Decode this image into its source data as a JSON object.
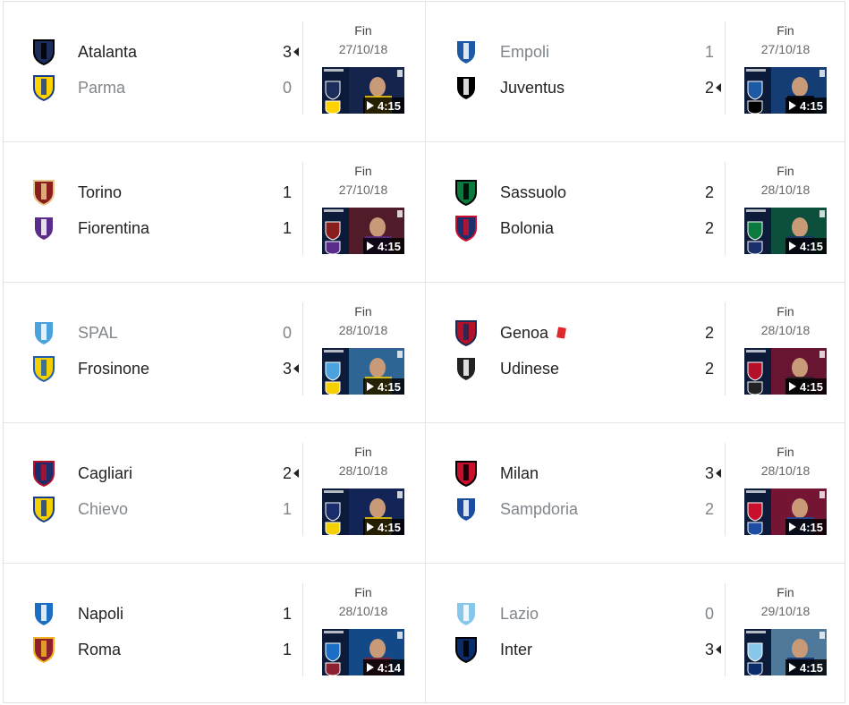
{
  "matches": [
    {
      "status": "Fin",
      "date": "27/10/18",
      "duration": "4:15",
      "winner": 1,
      "home": {
        "name": "Atalanta",
        "score": "3",
        "logo": "atalanta-crest-icon",
        "c1": "#1c2c5b",
        "c2": "#000000"
      },
      "away": {
        "name": "Parma",
        "score": "0",
        "logo": "parma-crest-icon",
        "c1": "#ffd200",
        "c2": "#1a3e8c"
      }
    },
    {
      "status": "Fin",
      "date": "27/10/18",
      "duration": "4:15",
      "winner": 2,
      "home": {
        "name": "Empoli",
        "score": "1",
        "logo": "empoli-crest-icon",
        "c1": "#1c5aa6",
        "c2": "#ffffff"
      },
      "away": {
        "name": "Juventus",
        "score": "2",
        "logo": "juventus-crest-icon",
        "c1": "#000000",
        "c2": "#ffffff"
      }
    },
    {
      "status": "Fin",
      "date": "27/10/18",
      "duration": "4:15",
      "winner": 0,
      "home": {
        "name": "Torino",
        "score": "1",
        "logo": "torino-crest-icon",
        "c1": "#8a1e1e",
        "c2": "#e8c58a"
      },
      "away": {
        "name": "Fiorentina",
        "score": "1",
        "logo": "fiorentina-crest-icon",
        "c1": "#5a2d8c",
        "c2": "#ffffff"
      }
    },
    {
      "status": "Fin",
      "date": "28/10/18",
      "duration": "4:15",
      "winner": 0,
      "home": {
        "name": "Sassuolo",
        "score": "2",
        "logo": "sassuolo-crest-icon",
        "c1": "#0b7a3e",
        "c2": "#000000"
      },
      "away": {
        "name": "Bolonia",
        "score": "2",
        "logo": "bologna-crest-icon",
        "c1": "#1a2f6b",
        "c2": "#c8102e"
      }
    },
    {
      "status": "Fin",
      "date": "28/10/18",
      "duration": "4:15",
      "winner": 2,
      "home": {
        "name": "SPAL",
        "score": "0",
        "logo": "spal-crest-icon",
        "c1": "#4aa3df",
        "c2": "#ffffff"
      },
      "away": {
        "name": "Frosinone",
        "score": "3",
        "logo": "frosinone-crest-icon",
        "c1": "#f5d000",
        "c2": "#1f5fb0"
      }
    },
    {
      "status": "Fin",
      "date": "28/10/18",
      "duration": "4:15",
      "winner": 0,
      "redcard": true,
      "home": {
        "name": "Genoa",
        "score": "2",
        "logo": "genoa-crest-icon",
        "c1": "#b5102a",
        "c2": "#1b2a55"
      },
      "away": {
        "name": "Udinese",
        "score": "2",
        "logo": "udinese-crest-icon",
        "c1": "#222222",
        "c2": "#ffffff"
      }
    },
    {
      "status": "Fin",
      "date": "28/10/18",
      "duration": "4:15",
      "winner": 1,
      "home": {
        "name": "Cagliari",
        "score": "2",
        "logo": "cagliari-crest-icon",
        "c1": "#1a2e6e",
        "c2": "#b5102a"
      },
      "away": {
        "name": "Chievo",
        "score": "1",
        "logo": "chievo-crest-icon",
        "c1": "#f5d000",
        "c2": "#1a3e8c"
      }
    },
    {
      "status": "Fin",
      "date": "28/10/18",
      "duration": "4:15",
      "winner": 1,
      "home": {
        "name": "Milan",
        "score": "3",
        "logo": "milan-crest-icon",
        "c1": "#c8102e",
        "c2": "#000000"
      },
      "away": {
        "name": "Sampdoria",
        "score": "2",
        "logo": "sampdoria-crest-icon",
        "c1": "#1c4da1",
        "c2": "#ffffff"
      }
    },
    {
      "status": "Fin",
      "date": "28/10/18",
      "duration": "4:14",
      "winner": 0,
      "home": {
        "name": "Napoli",
        "score": "1",
        "logo": "napoli-crest-icon",
        "c1": "#1a6fc4",
        "c2": "#ffffff"
      },
      "away": {
        "name": "Roma",
        "score": "1",
        "logo": "roma-crest-icon",
        "c1": "#8e1f2f",
        "c2": "#f0b323"
      }
    },
    {
      "status": "Fin",
      "date": "29/10/18",
      "duration": "4:15",
      "winner": 2,
      "home": {
        "name": "Lazio",
        "score": "0",
        "logo": "lazio-crest-icon",
        "c1": "#87c7ea",
        "c2": "#ffffff"
      },
      "away": {
        "name": "Inter",
        "score": "3",
        "logo": "inter-crest-icon",
        "c1": "#0a2c6b",
        "c2": "#000000"
      }
    }
  ]
}
